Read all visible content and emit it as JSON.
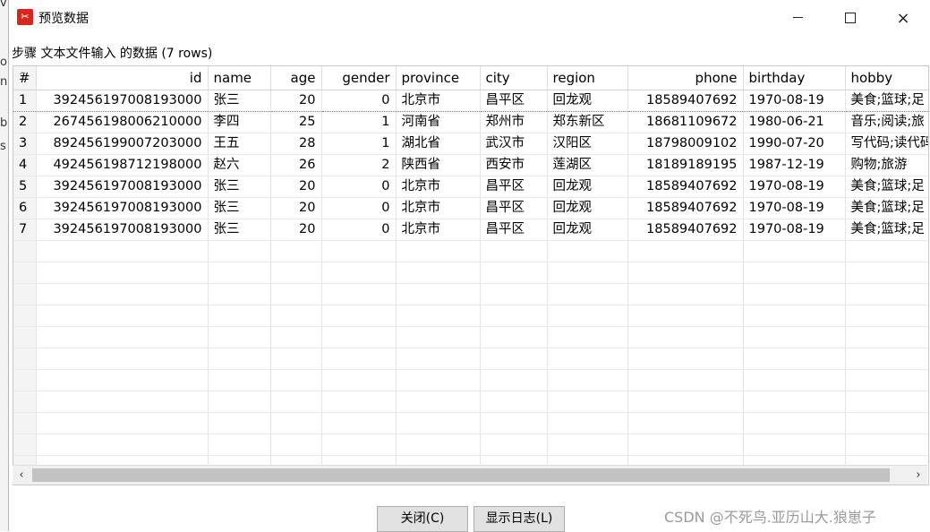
{
  "window": {
    "title": "预览数据",
    "icon": "kettle-app-icon",
    "controls": {
      "minimize": "minimize",
      "maximize": "maximize",
      "close": "×"
    }
  },
  "step_label": "步骤 文本文件输入 的数据  (7 rows)",
  "grid": {
    "columns": [
      "#",
      "id",
      "name",
      "age",
      "gender",
      "province",
      "city",
      "region",
      "phone",
      "birthday",
      "hobby"
    ],
    "rows": [
      [
        "1",
        "392456197008193000",
        "张三",
        "20",
        "0",
        "北京市",
        "昌平区",
        "回龙观",
        "18589407692",
        "1970-08-19",
        "美食;篮球;足"
      ],
      [
        "2",
        "267456198006210000",
        "李四",
        "25",
        "1",
        "河南省",
        "郑州市",
        "郑东新区",
        "18681109672",
        "1980-06-21",
        "音乐;阅读;旅"
      ],
      [
        "3",
        "892456199007203000",
        "王五",
        "28",
        "1",
        "湖北省",
        "武汉市",
        "汉阳区",
        "18798009102",
        "1990-07-20",
        "写代码;读代码"
      ],
      [
        "4",
        "492456198712198000",
        "赵六",
        "26",
        "2",
        "陕西省",
        "西安市",
        "莲湖区",
        "18189189195",
        "1987-12-19",
        "购物;旅游"
      ],
      [
        "5",
        "392456197008193000",
        "张三",
        "20",
        "0",
        "北京市",
        "昌平区",
        "回龙观",
        "18589407692",
        "1970-08-19",
        "美食;篮球;足"
      ],
      [
        "6",
        "392456197008193000",
        "张三",
        "20",
        "0",
        "北京市",
        "昌平区",
        "回龙观",
        "18589407692",
        "1970-08-19",
        "美食;篮球;足"
      ],
      [
        "7",
        "392456197008193000",
        "张三",
        "20",
        "0",
        "北京市",
        "昌平区",
        "回龙观",
        "18589407692",
        "1970-08-19",
        "美食;篮球;足"
      ]
    ]
  },
  "buttons": {
    "close": "关闭(C)",
    "show_log": "显示日志(L)"
  },
  "watermark": "CSDN @不死鸟.亚历山大.狼崽子",
  "background_text": [
    "vi",
    "o",
    "n",
    "b",
    "s"
  ],
  "colors": {
    "icon_red": "#d4281e",
    "button_bg": "#e1e1e1",
    "scroll_thumb": "#c2c2c2"
  }
}
